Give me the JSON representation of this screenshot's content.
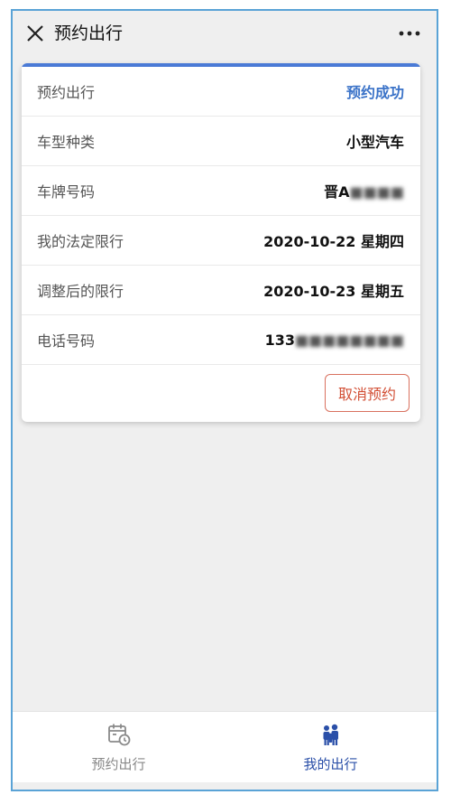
{
  "header": {
    "title": "预约出行",
    "close_icon": "close-icon",
    "more_icon": "more-icon"
  },
  "card": {
    "accent_color": "#4a7ad6",
    "rows": [
      {
        "label": "预约出行",
        "value": "预约成功"
      },
      {
        "label": "车型种类",
        "value": "小型汽车"
      },
      {
        "label": "车牌号码",
        "value": "晋A",
        "value_blurred": "■■■■"
      },
      {
        "label": "我的法定限行",
        "value": "2020-10-22 星期四"
      },
      {
        "label": "调整后的限行",
        "value": "2020-10-23 星期五"
      },
      {
        "label": "电话号码",
        "value": "133",
        "value_blurred": "■■■■■■■■"
      }
    ],
    "cancel_label": "取消预约"
  },
  "bottom_nav": {
    "items": [
      {
        "label": "预约出行",
        "icon": "calendar-clock-icon",
        "active": false
      },
      {
        "label": "我的出行",
        "icon": "people-icon",
        "active": true
      }
    ]
  },
  "colors": {
    "status": "#3b73c8",
    "cancel": "#d24e34",
    "nav_active": "#2a4fa8"
  }
}
